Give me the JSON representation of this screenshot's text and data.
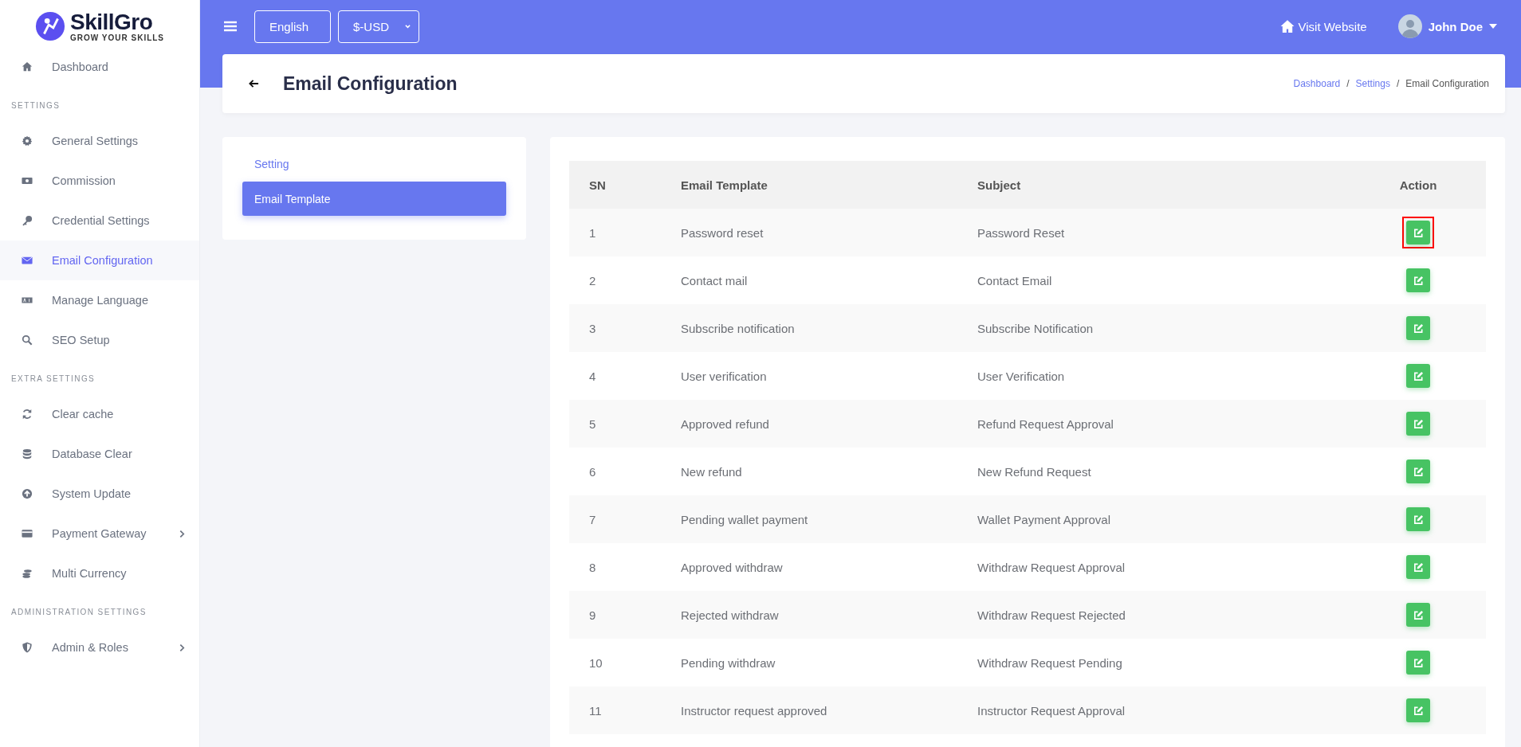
{
  "brand": {
    "name": "SkillGro",
    "tagline": "GROW YOUR SKILLS"
  },
  "sidebar": {
    "items": [
      {
        "label": "Dashboard",
        "selected": false,
        "has_submenu": false
      }
    ],
    "sections": [
      {
        "title": "SETTINGS",
        "items": [
          {
            "label": "General Settings",
            "selected": false,
            "has_submenu": false
          },
          {
            "label": "Commission",
            "selected": false,
            "has_submenu": false
          },
          {
            "label": "Credential Settings",
            "selected": false,
            "has_submenu": false
          },
          {
            "label": "Email Configuration",
            "selected": true,
            "has_submenu": false
          },
          {
            "label": "Manage Language",
            "selected": false,
            "has_submenu": false
          },
          {
            "label": "SEO Setup",
            "selected": false,
            "has_submenu": false
          }
        ]
      },
      {
        "title": "EXTRA SETTINGS",
        "items": [
          {
            "label": "Clear cache",
            "selected": false,
            "has_submenu": false
          },
          {
            "label": "Database Clear",
            "selected": false,
            "has_submenu": false
          },
          {
            "label": "System Update",
            "selected": false,
            "has_submenu": false
          },
          {
            "label": "Payment Gateway",
            "selected": false,
            "has_submenu": true
          },
          {
            "label": "Multi Currency",
            "selected": false,
            "has_submenu": false
          }
        ]
      },
      {
        "title": "ADMINISTRATION SETTINGS",
        "items": [
          {
            "label": "Admin & Roles",
            "selected": false,
            "has_submenu": true
          }
        ]
      }
    ]
  },
  "topbar": {
    "language": "English",
    "currency": "$-USD",
    "visit_website": "Visit Website",
    "user": "John Doe"
  },
  "page": {
    "title": "Email Configuration",
    "breadcrumb_separator": "/",
    "breadcrumb": [
      {
        "label": "Dashboard",
        "link": true
      },
      {
        "label": "Settings",
        "link": true
      },
      {
        "label": "Email Configuration",
        "link": false
      }
    ]
  },
  "tabs": [
    {
      "label": "Setting",
      "selected": false
    },
    {
      "label": "Email Template",
      "selected": true
    }
  ],
  "table": {
    "columns": [
      "SN",
      "Email Template",
      "Subject",
      "Action"
    ],
    "rows": [
      {
        "sn": "1",
        "template": "Password reset",
        "subject": "Password Reset",
        "highlighted": true
      },
      {
        "sn": "2",
        "template": "Contact mail",
        "subject": "Contact Email",
        "highlighted": false
      },
      {
        "sn": "3",
        "template": "Subscribe notification",
        "subject": "Subscribe Notification",
        "highlighted": false
      },
      {
        "sn": "4",
        "template": "User verification",
        "subject": "User Verification",
        "highlighted": false
      },
      {
        "sn": "5",
        "template": "Approved refund",
        "subject": "Refund Request Approval",
        "highlighted": false
      },
      {
        "sn": "6",
        "template": "New refund",
        "subject": "New Refund Request",
        "highlighted": false
      },
      {
        "sn": "7",
        "template": "Pending wallet payment",
        "subject": "Wallet Payment Approval",
        "highlighted": false
      },
      {
        "sn": "8",
        "template": "Approved withdraw",
        "subject": "Withdraw Request Approval",
        "highlighted": false
      },
      {
        "sn": "9",
        "template": "Rejected withdraw",
        "subject": "Withdraw Request Rejected",
        "highlighted": false
      },
      {
        "sn": "10",
        "template": "Pending withdraw",
        "subject": "Withdraw Request Pending",
        "highlighted": false
      },
      {
        "sn": "11",
        "template": "Instructor request approved",
        "subject": "Instructor Request Approval",
        "highlighted": false
      }
    ]
  }
}
